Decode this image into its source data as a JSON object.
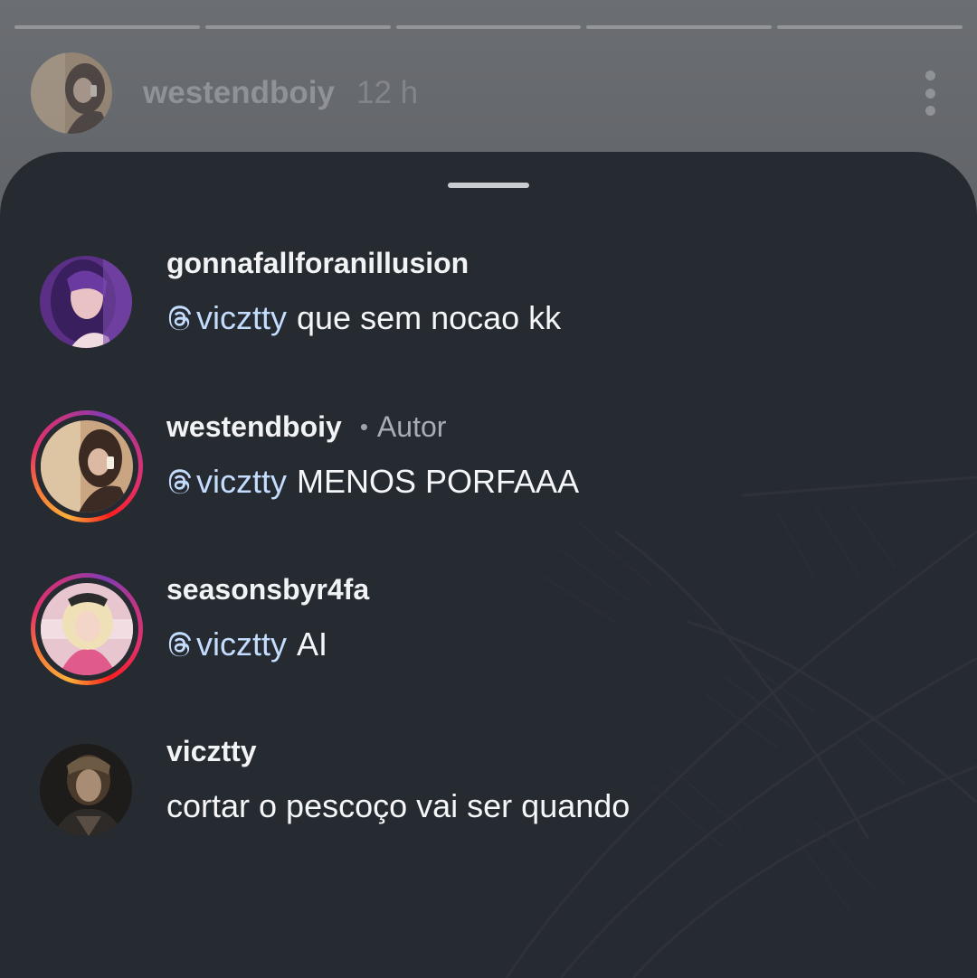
{
  "story": {
    "progress_segments": 5,
    "username": "westendboiy",
    "time": "12 h",
    "more_icon": "more-vertical-icon"
  },
  "comments": [
    {
      "username": "gonnafallforanillusion",
      "mention": "vicztty",
      "text": "que sem nocao kk",
      "has_story_ring": false
    },
    {
      "username": "westendboiy",
      "separator": "•",
      "tag": "Autor",
      "mention": "vicztty",
      "text": "MENOS PORFAAA",
      "has_story_ring": true
    },
    {
      "username": "seasonsbyr4fa",
      "mention": "vicztty",
      "text": "AI",
      "has_story_ring": true
    },
    {
      "username": "vicztty",
      "text": "cortar o pescoço vai ser quando",
      "has_story_ring": false
    }
  ],
  "colors": {
    "sheet_background": "#262a31",
    "mention_color": "#c4ddff",
    "primary_text": "#f5f6f8",
    "secondary_text": "#a8acb3"
  }
}
